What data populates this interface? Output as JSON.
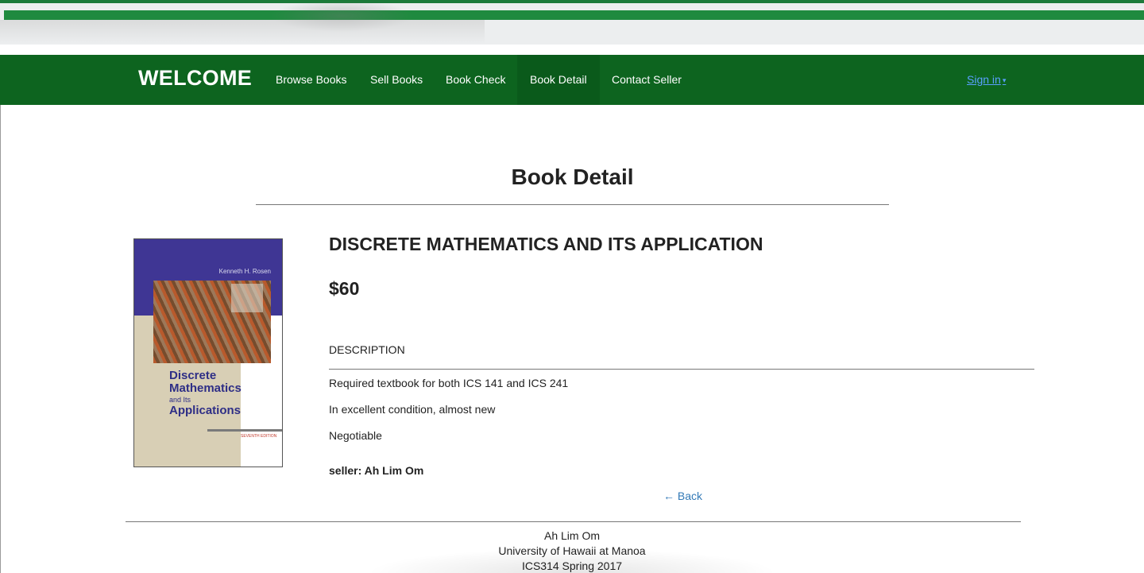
{
  "navbar": {
    "brand": "WELCOME",
    "items": [
      "Browse Books",
      "Sell Books",
      "Book Check",
      "Book Detail",
      "Contact Seller"
    ],
    "active": "Book Detail",
    "signin": "Sign in",
    "signin_caret": "▾"
  },
  "page": {
    "title": "Book Detail"
  },
  "book": {
    "cover": {
      "author": "Kenneth H. Rosen",
      "title_line1": "Discrete",
      "title_line2": "Mathematics",
      "title_line3": "and Its",
      "title_line4": "Applications",
      "edition": "SEVENTH EDITION"
    },
    "title": "DISCRETE MATHEMATICS AND ITS APPLICATION",
    "price": "$60",
    "description_heading": "DESCRIPTION",
    "description": [
      "Required textbook for both ICS 141 and ICS 241",
      "In excellent condition, almost new",
      "Negotiable"
    ],
    "seller": "seller: Ah Lim Om",
    "back": "← Back"
  },
  "footer": {
    "lines": [
      "Ah Lim Om",
      "University of Hawaii at Manoa",
      "ICS314 Spring 2017"
    ]
  },
  "colors": {
    "navbar": "#0d641f",
    "link": "#337ab7",
    "signin": "#5aa0ff"
  }
}
